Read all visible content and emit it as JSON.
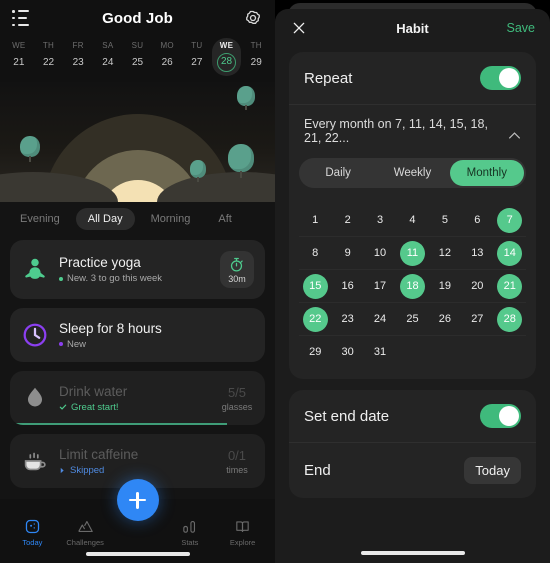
{
  "left": {
    "header": {
      "title": "Good Job",
      "menu_icon": "list-menu-icon",
      "settings_icon": "gear-icon"
    },
    "week": [
      {
        "dow": "WE",
        "num": "21",
        "selected": false
      },
      {
        "dow": "TH",
        "num": "22",
        "selected": false
      },
      {
        "dow": "FR",
        "num": "23",
        "selected": false
      },
      {
        "dow": "SA",
        "num": "24",
        "selected": false
      },
      {
        "dow": "SU",
        "num": "25",
        "selected": false
      },
      {
        "dow": "MO",
        "num": "26",
        "selected": false
      },
      {
        "dow": "TU",
        "num": "27",
        "selected": false
      },
      {
        "dow": "WE",
        "num": "28",
        "selected": true
      },
      {
        "dow": "TH",
        "num": "29",
        "selected": false
      }
    ],
    "period_tabs": [
      {
        "label": "Evening",
        "active": false
      },
      {
        "label": "All Day",
        "active": true
      },
      {
        "label": "Morning",
        "active": false
      },
      {
        "label": "Aft",
        "active": false
      }
    ],
    "habits": [
      {
        "name": "Practice yoga",
        "status": "New. 3 to go this week",
        "state": "new",
        "icon": "yoga-meditation-icon",
        "icon_color": "#4ecb8e",
        "dot_color": "#4ecb8e",
        "right_type": "timer",
        "timer_label": "30m",
        "timer_icon": "stopwatch-icon"
      },
      {
        "name": "Sleep for 8 hours",
        "status": "New",
        "state": "new",
        "icon": "clock-icon",
        "icon_color": "#8b3ff0",
        "dot_color": "#8b3ff0",
        "right_type": "none"
      },
      {
        "name": "Drink water",
        "status": "Great start!",
        "state": "done",
        "icon": "water-drop-icon",
        "icon_color": "#9a9a9a",
        "right_type": "count",
        "count_value": "5/5",
        "count_unit": "glasses",
        "progress_pct": 85
      },
      {
        "name": "Limit caffeine",
        "status": "Skipped",
        "state": "skipped",
        "icon": "coffee-cup-icon",
        "icon_color": "#9a9a9a",
        "right_type": "count",
        "count_value": "0/1",
        "count_unit": "times",
        "progress_pct": 0
      }
    ],
    "fab": {
      "icon": "plus-icon"
    },
    "nav": [
      {
        "label": "Today",
        "icon": "today-square-icon",
        "active": true
      },
      {
        "label": "Challenges",
        "icon": "mountains-icon",
        "active": false
      },
      {
        "label": "Stats",
        "icon": "bar-chart-icon",
        "active": false
      },
      {
        "label": "Explore",
        "icon": "open-book-icon",
        "active": false
      }
    ]
  },
  "right": {
    "header": {
      "title": "Habit",
      "close_icon": "close-x-icon",
      "save_label": "Save"
    },
    "repeat": {
      "label": "Repeat",
      "enabled": true,
      "summary": "Every month on 7, 11, 14, 15, 18, 21, 22...",
      "chevron_icon": "chevron-up-icon"
    },
    "frequency": {
      "options": [
        {
          "label": "Daily",
          "active": false
        },
        {
          "label": "Weekly",
          "active": false
        },
        {
          "label": "Monthly",
          "active": true
        }
      ]
    },
    "calendar": {
      "selected_days": [
        7,
        11,
        14,
        15,
        18,
        21,
        22,
        28
      ],
      "rows": [
        [
          "1",
          "2",
          "3",
          "4",
          "5",
          "6",
          "7"
        ],
        [
          "8",
          "9",
          "10",
          "11",
          "12",
          "13",
          "14"
        ],
        [
          "15",
          "16",
          "17",
          "18",
          "19",
          "20",
          "21"
        ],
        [
          "22",
          "23",
          "24",
          "25",
          "26",
          "27",
          "28"
        ],
        [
          "29",
          "30",
          "31",
          "",
          "",
          "",
          ""
        ]
      ]
    },
    "end_date": {
      "toggle_label": "Set end date",
      "enabled": true,
      "end_label": "End",
      "end_value": "Today"
    }
  },
  "colors": {
    "accent_green": "#55c98c",
    "accent_blue": "#2f87f5",
    "purple": "#8b3ff0",
    "skipped_blue": "#4f8ae0"
  }
}
